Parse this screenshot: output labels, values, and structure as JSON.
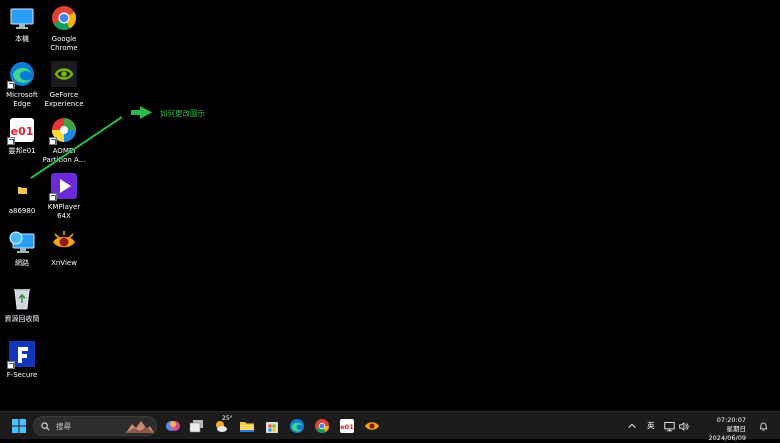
{
  "desktop": {
    "icons": [
      {
        "label": "本機",
        "icon": "monitor-icon"
      },
      {
        "label": "Google\nChrome",
        "icon": "chrome-icon"
      },
      {
        "label": "Microsoft\nEdge",
        "icon": "edge-icon"
      },
      {
        "label": "GeForce\nExperience",
        "icon": "geforce-icon"
      },
      {
        "label": "靈邦e01",
        "icon": "e01-icon"
      },
      {
        "label": "AOMEI\nPartition A...",
        "icon": "aomei-icon"
      },
      {
        "label": "a86980",
        "icon": "folder-icon"
      },
      {
        "label": "KMPlayer\n64X",
        "icon": "kmplayer-icon"
      },
      {
        "label": "網路",
        "icon": "network-icon"
      },
      {
        "label": "XnView",
        "icon": "xnview-icon"
      },
      {
        "label": "資源回收筒",
        "icon": "recycle-bin-icon"
      },
      {
        "label": "F-Secure",
        "icon": "fsecure-icon"
      }
    ],
    "annotation": "如何更改圖示",
    "annotation_color": "#2db84d"
  },
  "taskbar": {
    "search_placeholder": "搜尋",
    "weather_temp": "25°",
    "input_method": "英",
    "clock_time": "07:20:07",
    "clock_date": "星期日 2024/06/09",
    "accent": "#0078d4"
  }
}
